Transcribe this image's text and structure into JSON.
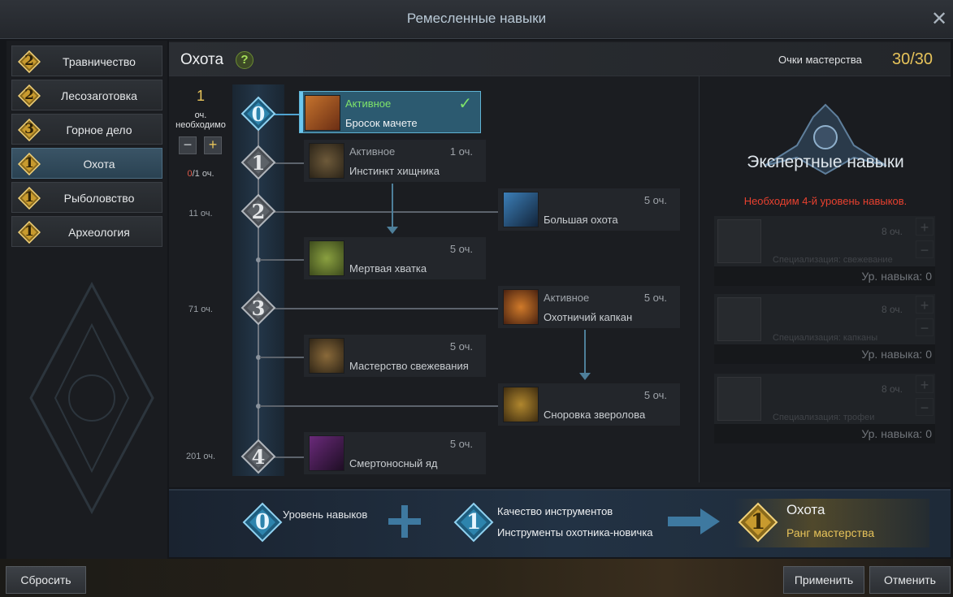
{
  "window": {
    "title": "Ремесленные навыки",
    "close_symbol": "✕"
  },
  "sidebar": {
    "items": [
      {
        "level": "2",
        "label": "Травничество",
        "color": "#d4a437"
      },
      {
        "level": "2",
        "label": "Лесозаготовка",
        "color": "#d4a437"
      },
      {
        "level": "3",
        "label": "Горное дело",
        "color": "#d4a437"
      },
      {
        "level": "1",
        "label": "Охота",
        "color": "#d4a437",
        "active": true
      },
      {
        "level": "1",
        "label": "Рыболовство",
        "color": "#d4a437"
      },
      {
        "level": "1",
        "label": "Археология",
        "color": "#d4a437"
      }
    ]
  },
  "header": {
    "section_title": "Охота",
    "help_symbol": "?",
    "mastery_label": "Очки мастерства",
    "mastery_value": "30/30"
  },
  "cost": {
    "required_num": "1",
    "required_label": "оч. необходимо",
    "minus_symbol": "−",
    "plus_symbol": "+",
    "points_spent": "0",
    "points_total": "/1 оч.",
    "tier_requirements": [
      "11 оч.",
      "71 оч.",
      "201 оч."
    ]
  },
  "tiers": [
    {
      "num": "0",
      "color": "#4fa3d0"
    },
    {
      "num": "1",
      "color": "#8e949a"
    },
    {
      "num": "2",
      "color": "#8e949a"
    },
    {
      "num": "3",
      "color": "#8e949a"
    },
    {
      "num": "4",
      "color": "#8e949a"
    }
  ],
  "nodes": [
    {
      "type": "Активное",
      "name": "Бросок мачете",
      "cost": "",
      "selected": true,
      "icon": "machete-icon"
    },
    {
      "type": "Активное",
      "name": "Инстинкт хищника",
      "cost": "1 оч.",
      "icon": "predator-icon"
    },
    {
      "type": "",
      "name": "Большая охота",
      "cost": "5 оч.",
      "icon": "big-hunt-icon"
    },
    {
      "type": "",
      "name": "Мертвая хватка",
      "cost": "5 оч.",
      "icon": "death-grip-icon"
    },
    {
      "type": "Активное",
      "name": "Охотничий капкан",
      "cost": "5 оч.",
      "icon": "trap-icon"
    },
    {
      "type": "",
      "name": "Мастерство свежевания",
      "cost": "5 оч.",
      "icon": "skinning-icon"
    },
    {
      "type": "",
      "name": "Сноровка звероловa",
      "cost": "5 оч.",
      "icon": "trapper-icon"
    },
    {
      "type": "",
      "name": "Смертоносный яд",
      "cost": "5 оч.",
      "icon": "poison-icon"
    }
  ],
  "expert": {
    "title": "Экспертные навыки",
    "requirement": "Необходим 4-й уровень навыков.",
    "cards": [
      {
        "cost": "8 оч.",
        "spec": "Специализация: свежевание",
        "level": "Ур. навыка: 0"
      },
      {
        "cost": "8 оч.",
        "spec": "Специализация: капканы",
        "level": "Ур. навыка: 0"
      },
      {
        "cost": "8 оч.",
        "spec": "Специализация: трофеи",
        "level": "Ур. навыка: 0"
      }
    ]
  },
  "bottom": {
    "skill_level_num": "0",
    "skill_level_label": "Уровень навыков",
    "tool_level_num": "1",
    "tool_quality_label": "Качество инструментов",
    "tool_name": "Инструменты охотника-новичка",
    "result_level_num": "1",
    "result_name": "Охота",
    "result_rank": "Ранг мастерства"
  },
  "buttons": {
    "reset": "Сбросить",
    "apply": "Применить",
    "cancel": "Отменить"
  }
}
